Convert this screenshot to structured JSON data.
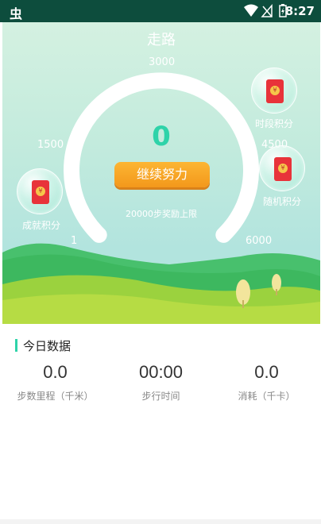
{
  "status_bar": {
    "app_glyph": "虫",
    "time": "8:27"
  },
  "hero": {
    "title": "走路",
    "steps": "0",
    "continue_label": "继续努力",
    "reward_note": "20000步奖励上限",
    "gauge_ticks": {
      "min": "1",
      "low": "1500",
      "mid": "3000",
      "high": "4500",
      "max": "6000"
    },
    "bubbles": {
      "achievement": "成就积分",
      "timed": "时段积分",
      "random": "随机积分"
    },
    "envelope_symbol": "¥"
  },
  "today": {
    "title": "今日数据",
    "stats": [
      {
        "value": "0.0",
        "label": "步数里程（千米）"
      },
      {
        "value": "00:00",
        "label": "步行时间"
      },
      {
        "value": "0.0",
        "label": "消耗（千卡）"
      }
    ]
  },
  "colors": {
    "accent": "#2ed3a9",
    "status_bar": "#0d4d3d",
    "button": "#f3981b"
  }
}
